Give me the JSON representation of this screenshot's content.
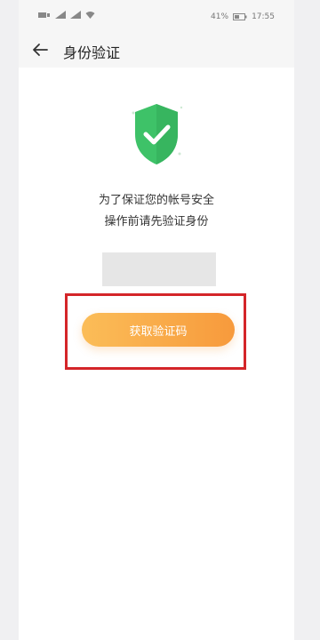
{
  "status_bar": {
    "battery": "41%",
    "time": "17:55"
  },
  "header": {
    "title": "身份验证"
  },
  "main": {
    "message_line1": "为了保证您的帐号安全",
    "message_line2": "操作前请先验证身份",
    "phone_value": "",
    "button_label": "获取验证码"
  },
  "colors": {
    "shield_green": "#3ec268",
    "button_orange": "#f9a84a",
    "highlight_red": "#d42529"
  },
  "icons": {
    "back": "arrow-left-icon",
    "shield": "shield-check-icon"
  }
}
